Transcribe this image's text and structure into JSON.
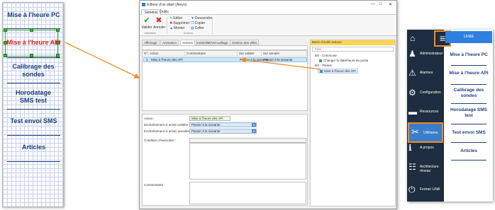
{
  "left_panel": {
    "buttons": [
      {
        "label": "Mise à l'heure PC"
      },
      {
        "label": "Mise à l'heure API"
      },
      {
        "label": "Calibrage des sondes"
      },
      {
        "label": "Horodatage SMS test"
      },
      {
        "label": "Test envoi SMS"
      },
      {
        "label": "Articles"
      }
    ]
  },
  "editor": {
    "title": "Editeur d'un objet (Ateyo)",
    "window_controls": [
      "—",
      "□",
      "✕"
    ],
    "ribbon_tabs": [
      "Général",
      "Outils"
    ],
    "ribbon": {
      "valider": "Valider",
      "annuler": "Annuler",
      "editer": "Editer",
      "supprimer": "Supprimer",
      "monter": "Monter",
      "descendre": "Descendre",
      "copier": "Copier",
      "coller": "Coller",
      "group_validation": "Validation",
      "group_actions": "Actions"
    },
    "content_tabs": [
      "Affichage",
      "Animation",
      "Actions",
      "Invisibilité/Verrouillage",
      "Gestion des villes"
    ],
    "grid": {
      "headers": [
        "N°",
        "Action",
        "Commentaire",
        "Sur valider",
        "Sur annuler"
      ],
      "rows": [
        {
          "num": "1",
          "action": "Mise à l'heure des API",
          "comment": "",
          "on_validate": "Passer à la suivante",
          "on_cancel": "Passer à la suivante"
        }
      ]
    },
    "props": {
      "action_label": "Action :",
      "action_value": "Mise à l'heure des API",
      "on_validate_label": "Enchaînement si action validée :",
      "on_validate_value": "Passer à la suivante",
      "on_cancel_label": "Enchaînement si action annulée :",
      "on_cancel_value": "Passer à la suivante",
      "condition_label": "Condition d'exécution :",
      "comment_label": "Commentaire :"
    },
    "toolbox": {
      "title": "Barre d'outils actions",
      "search_placeholder": "Find",
      "group1": "BS - Commune",
      "group1_item": "Changer la date/heure du poste",
      "group2": "BG - Pilotes",
      "group2_item": "Mise à l'heure des API"
    }
  },
  "mobile": {
    "menu_icon": "hamburger-icon",
    "sidebar": [
      {
        "label": "",
        "icon": "home-icon"
      },
      {
        "label": "Administrateur",
        "icon": "user-admin-icon"
      },
      {
        "label": "Alarmes",
        "icon": "alarm-icon"
      },
      {
        "label": "Configuration",
        "icon": "gears-icon"
      },
      {
        "label": "Ressources",
        "icon": "resources-icon"
      },
      {
        "label": "Utilitaires",
        "icon": "tools-icon"
      },
      {
        "label": "A propos",
        "icon": "info-icon"
      },
      {
        "label": "Architecture réseau",
        "icon": "network-icon"
      },
      {
        "label": "Fermer LiNA",
        "icon": "power-icon"
      }
    ],
    "unite": "Unité",
    "buttons": [
      {
        "label": "Mise à l'heure PC"
      },
      {
        "label": "Mise à l'heure API"
      },
      {
        "label": "Calibrage des sondes"
      },
      {
        "label": "Horodatage SMS test"
      },
      {
        "label": "Test envoi SMS"
      },
      {
        "label": "Articles"
      }
    ]
  },
  "colors": {
    "accent_orange": "#f08a24",
    "nav_blue": "#1f3f7a",
    "highlight_red": "#e0231d",
    "sidebar_dark": "#1e2d3f",
    "unite_blue": "#2f7fe0"
  }
}
